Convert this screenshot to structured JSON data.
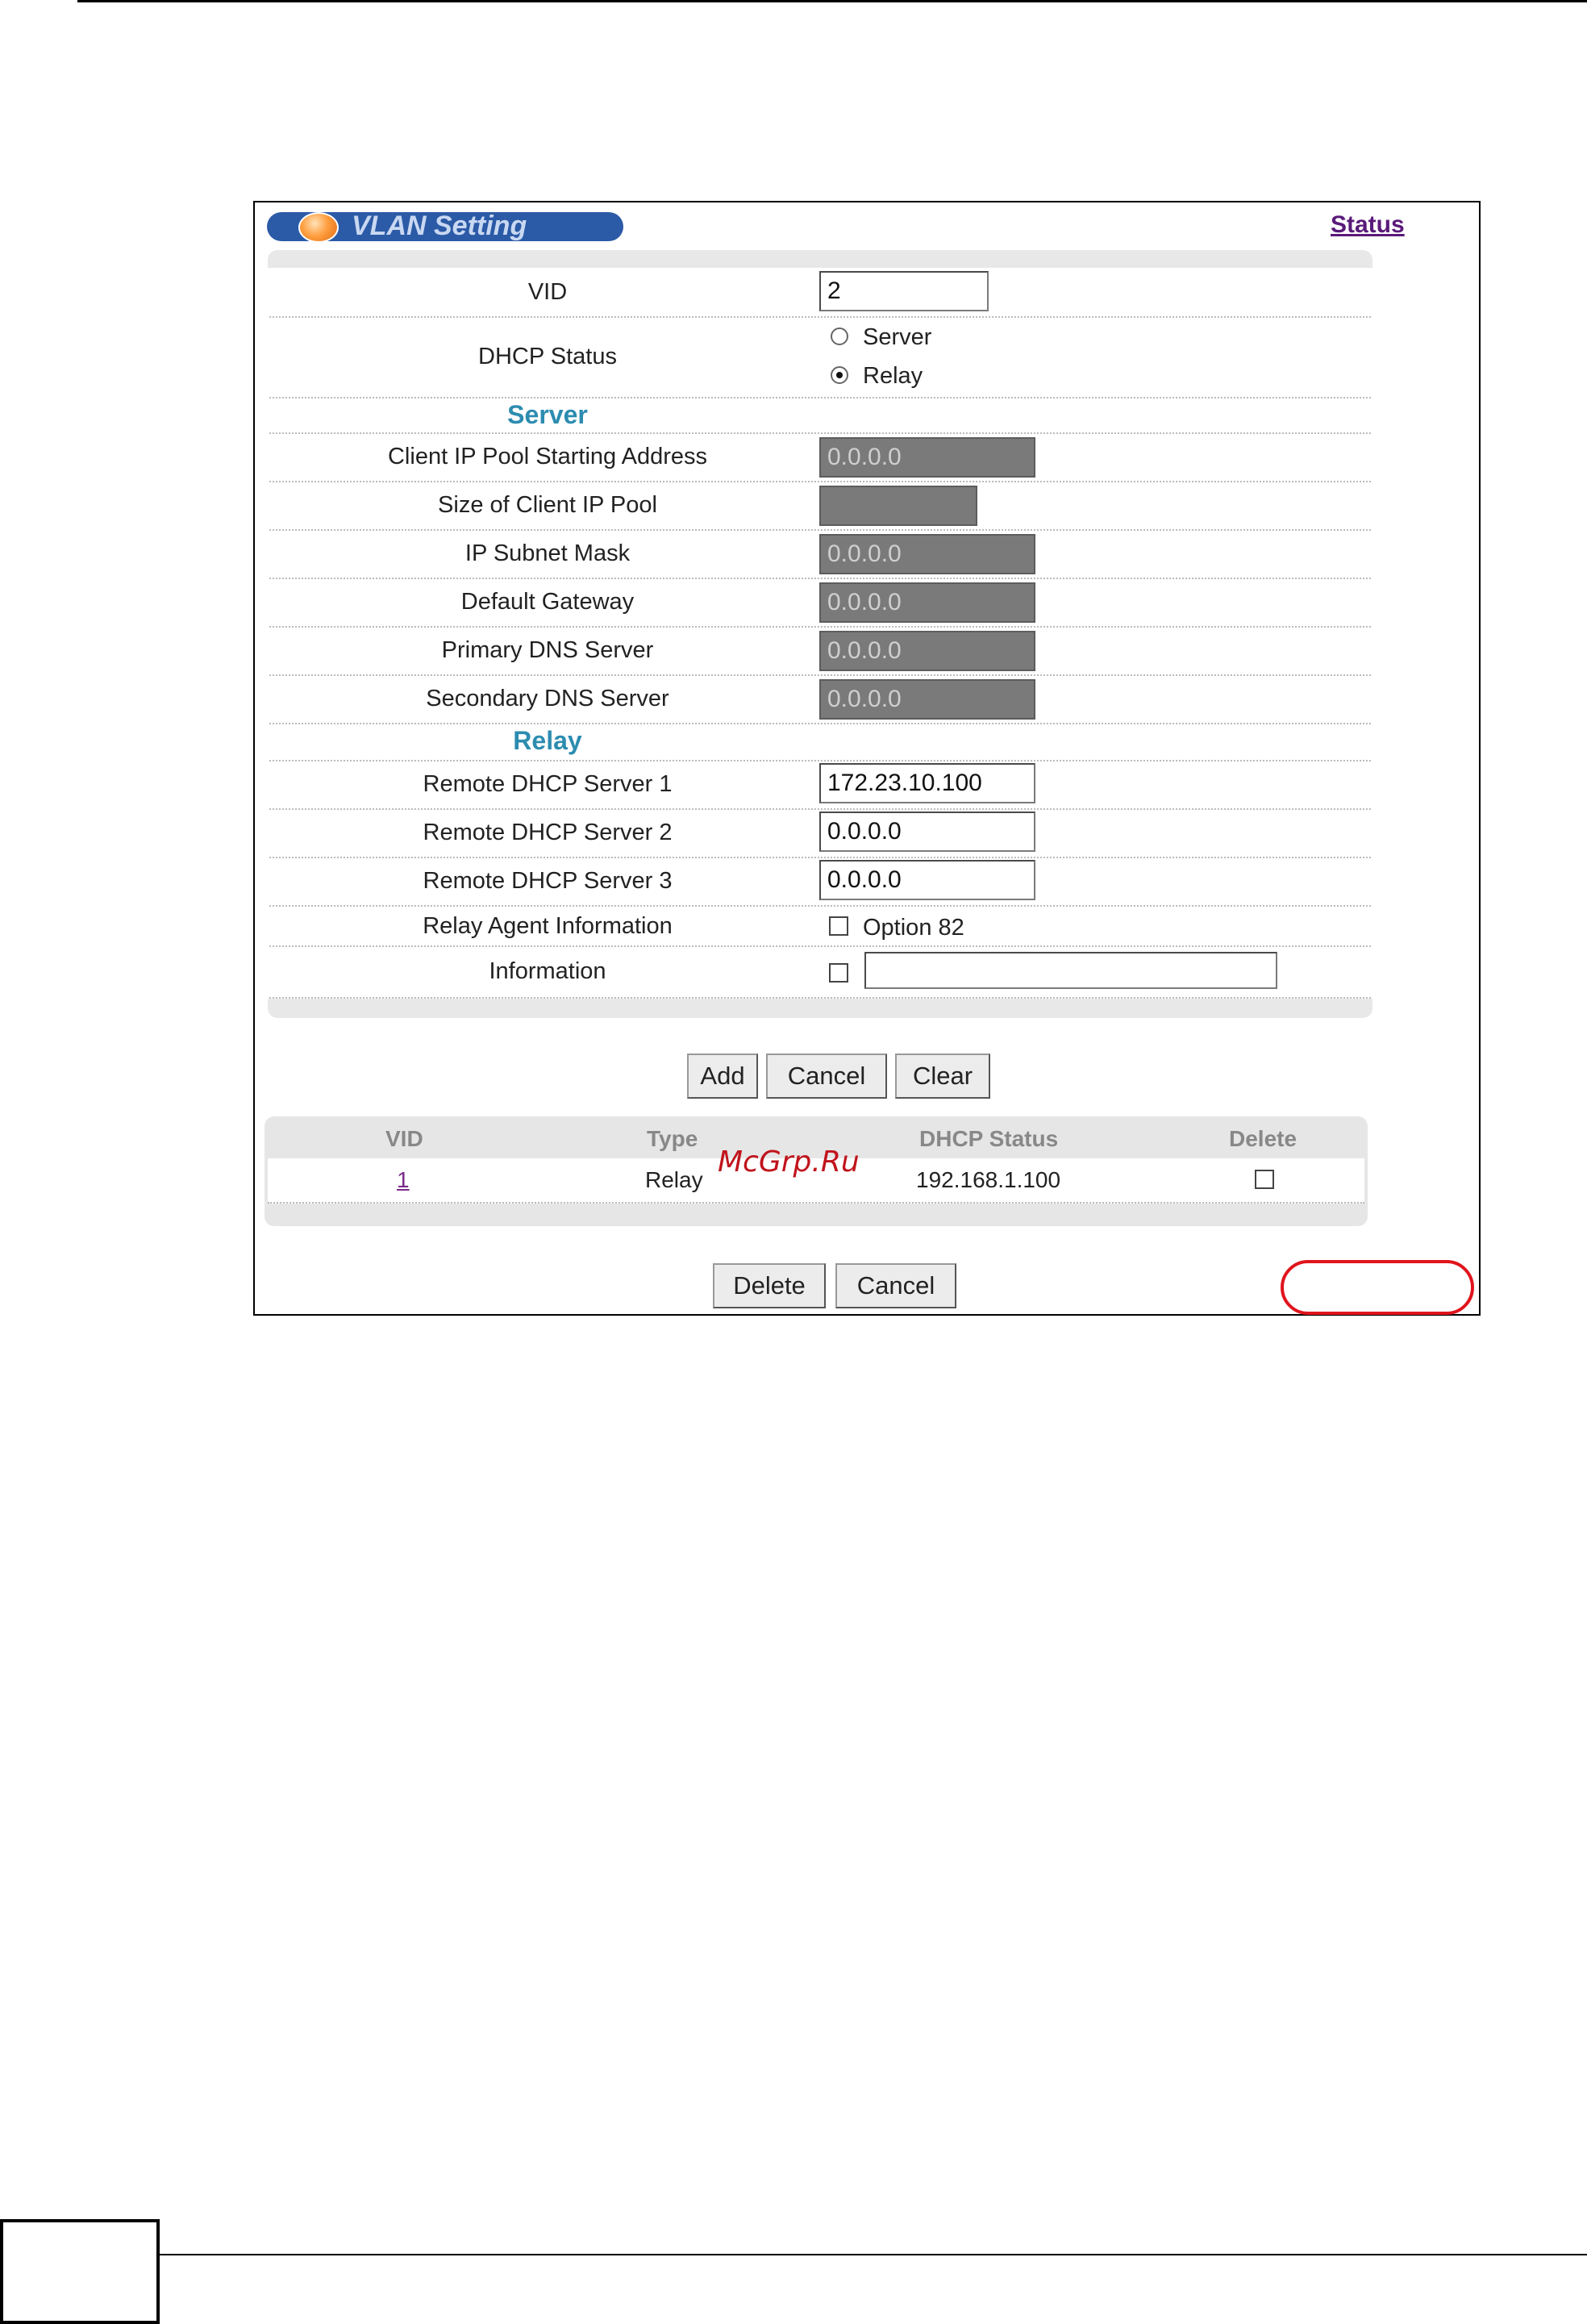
{
  "window": {
    "title": "VLAN Setting",
    "status_link": "Status"
  },
  "form": {
    "vid": {
      "label": "VID",
      "value": "2"
    },
    "dhcp_status": {
      "label": "DHCP Status",
      "options": [
        "Server",
        "Relay"
      ],
      "selected": "Relay"
    },
    "server_section": {
      "heading": "Server",
      "fields": [
        {
          "label": "Client IP Pool Starting Address",
          "value": "0.0.0.0"
        },
        {
          "label": "Size of Client IP Pool",
          "value": ""
        },
        {
          "label": "IP Subnet Mask",
          "value": "0.0.0.0"
        },
        {
          "label": "Default Gateway",
          "value": "0.0.0.0"
        },
        {
          "label": "Primary DNS Server",
          "value": "0.0.0.0"
        },
        {
          "label": "Secondary DNS Server",
          "value": "0.0.0.0"
        }
      ]
    },
    "relay_section": {
      "heading": "Relay",
      "fields": [
        {
          "label": "Remote DHCP Server 1",
          "value": "172.23.10.100"
        },
        {
          "label": "Remote DHCP Server 2",
          "value": "0.0.0.0"
        },
        {
          "label": "Remote DHCP Server 3",
          "value": "0.0.0.0"
        }
      ],
      "relay_agent": {
        "label": "Relay Agent Information",
        "option_label": "Option 82",
        "checked": false
      },
      "information": {
        "label": "Information",
        "checked": false,
        "value": ""
      }
    },
    "buttons": {
      "add": "Add",
      "cancel": "Cancel",
      "clear": "Clear"
    }
  },
  "list": {
    "headers": [
      "VID",
      "Type",
      "DHCP Status",
      "Delete"
    ],
    "rows": [
      {
        "vid": "1",
        "type": "Relay",
        "dhcp_status": "192.168.1.100",
        "delete": false
      }
    ],
    "buttons": {
      "delete": "Delete",
      "cancel": "Cancel"
    }
  },
  "watermark": "McGrp.Ru",
  "colors": {
    "title_pill": "#2b5aa6",
    "section_heading": "#2c8cb0",
    "status_link": "#5a1a7a",
    "highlight_oval": "#e0141c"
  }
}
